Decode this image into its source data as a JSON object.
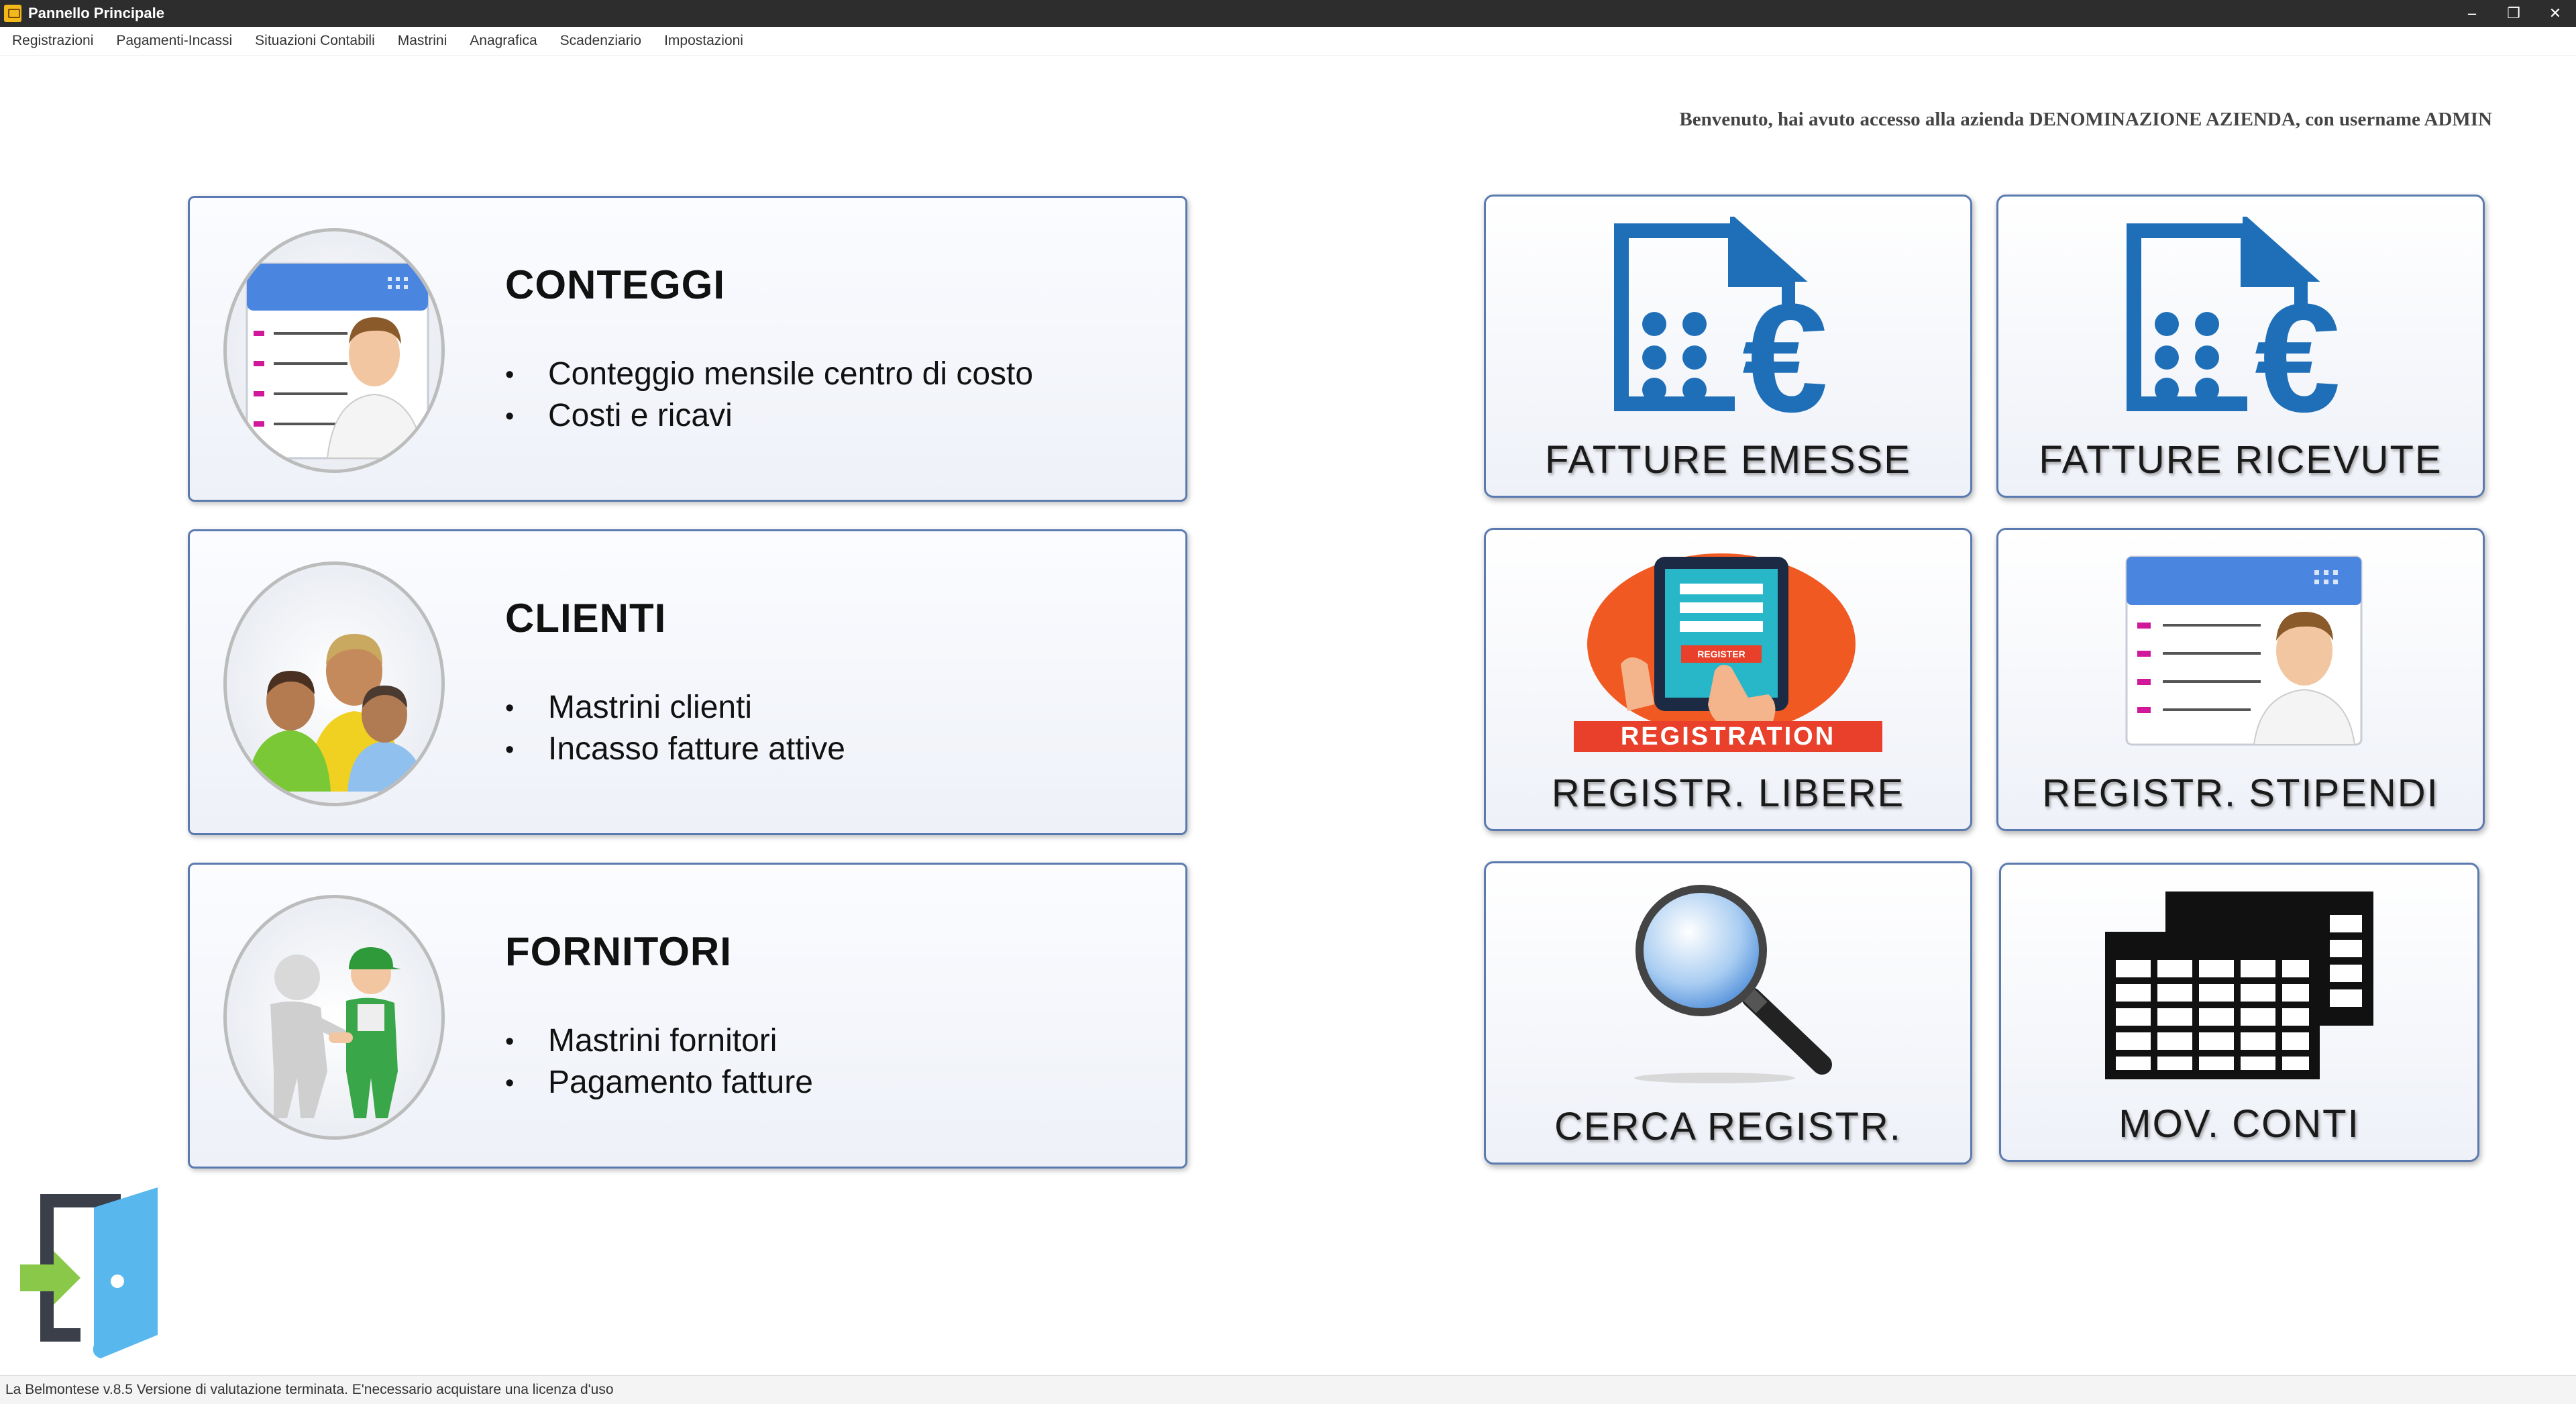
{
  "window": {
    "title": "Pannello Principale",
    "controls": [
      "–",
      "❐",
      "✕"
    ]
  },
  "menu": [
    "Registrazioni",
    "Pagamenti-Incassi",
    "Situazioni Contabili",
    "Mastrini",
    "Anagrafica",
    "Scadenziario",
    "Impostazioni"
  ],
  "welcome": "Benvenuto, hai avuto accesso alla azienda DENOMINAZIONE AZIENDA, con username ADMIN",
  "cards": [
    {
      "title": "CONTEGGI",
      "bullets": [
        "Conteggio mensile centro di costo",
        "Costi e ricavi"
      ],
      "icon": "user-form-icon"
    },
    {
      "title": "CLIENTI",
      "bullets": [
        "Mastrini clienti",
        "Incasso fatture attive"
      ],
      "icon": "clients-group-icon"
    },
    {
      "title": "FORNITORI",
      "bullets": [
        "Mastrini fornitori",
        "Pagamento fatture"
      ],
      "icon": "handshake-icon"
    }
  ],
  "tiles": [
    {
      "label": "FATTURE EMESSE",
      "icon": "invoice-euro-icon"
    },
    {
      "label": "FATTURE RICEVUTE",
      "icon": "invoice-euro-icon"
    },
    {
      "label": "REGISTR. LIBERE",
      "icon": "registration-tablet-icon",
      "art_text": "REGISTRATION",
      "art_small": "REGISTER"
    },
    {
      "label": "REGISTR. STIPENDI",
      "icon": "user-form-icon"
    },
    {
      "label": "CERCA REGISTR.",
      "icon": "magnifier-icon"
    },
    {
      "label": "MOV. CONTI",
      "icon": "spreadsheet-icon"
    }
  ],
  "colors": {
    "titlebar": "#2d2d2d",
    "card_border": "#5b7bb0",
    "invoice_blue": "#1f6fb8",
    "registration_orange": "#f05a22"
  },
  "status": "La Belmontese v.8.5 Versione di valutazione terminata. E'necessario acquistare una licenza d'uso"
}
